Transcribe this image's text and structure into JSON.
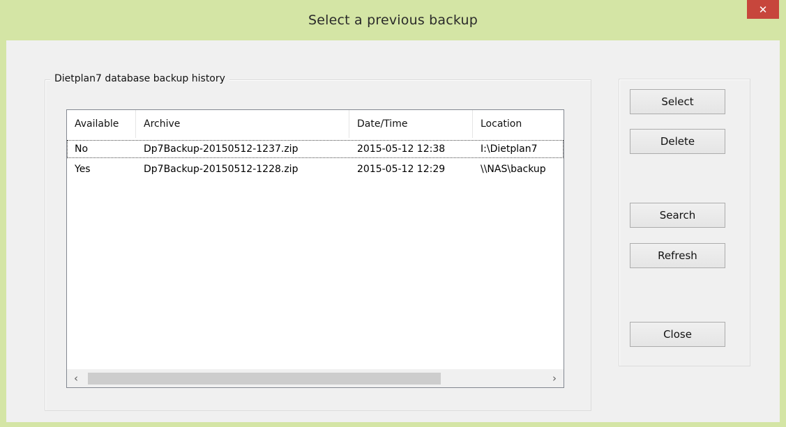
{
  "window": {
    "title": "Select a previous backup",
    "close_glyph": "✕",
    "accent_color": "#d4e5a5",
    "close_color": "#c7463c"
  },
  "group": {
    "title": "Dietplan7 database backup history"
  },
  "list": {
    "columns": [
      "Available",
      "Archive",
      "Date/Time",
      "Location"
    ],
    "rows": [
      {
        "available": "No",
        "archive": "Dp7Backup-20150512-1237.zip",
        "datetime": "2015-05-12 12:38",
        "location": "I:\\Dietplan7"
      },
      {
        "available": "Yes",
        "archive": "Dp7Backup-20150512-1228.zip",
        "datetime": "2015-05-12 12:29",
        "location": "\\\\NAS\\backup"
      }
    ],
    "scroll_left": "‹",
    "scroll_right": "›"
  },
  "buttons": {
    "select": "Select",
    "delete": "Delete",
    "search": "Search",
    "refresh": "Refresh",
    "close": "Close"
  }
}
